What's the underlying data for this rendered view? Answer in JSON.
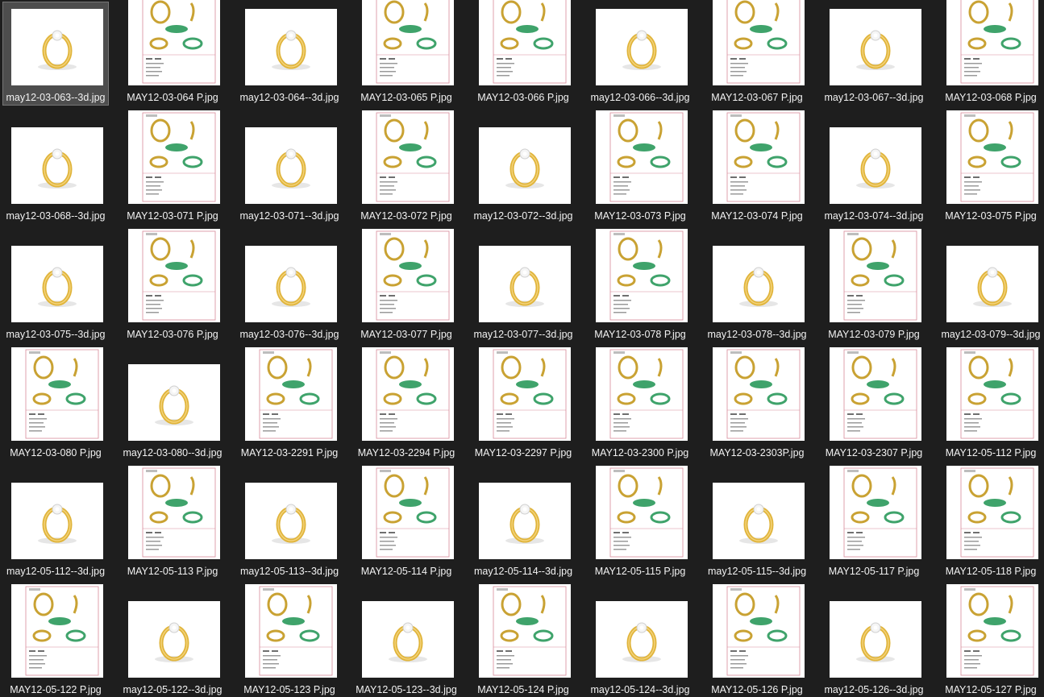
{
  "explorer": {
    "files": [
      {
        "name": "may12-03-063--3d.jpg",
        "kind": "render",
        "selected": true
      },
      {
        "name": "MAY12-03-064 P.jpg",
        "kind": "sheet"
      },
      {
        "name": "may12-03-064--3d.jpg",
        "kind": "render"
      },
      {
        "name": "MAY12-03-065 P.jpg",
        "kind": "sheet"
      },
      {
        "name": "MAY12-03-066 P.jpg",
        "kind": "sheet"
      },
      {
        "name": "may12-03-066--3d.jpg",
        "kind": "render"
      },
      {
        "name": "MAY12-03-067 P.jpg",
        "kind": "sheet"
      },
      {
        "name": "may12-03-067--3d.jpg",
        "kind": "render"
      },
      {
        "name": "MAY12-03-068 P.jpg",
        "kind": "sheet"
      },
      {
        "name": "may12-03-068--3d.jpg",
        "kind": "render"
      },
      {
        "name": "MAY12-03-071 P.jpg",
        "kind": "sheet"
      },
      {
        "name": "may12-03-071--3d.jpg",
        "kind": "render"
      },
      {
        "name": "MAY12-03-072 P.jpg",
        "kind": "sheet"
      },
      {
        "name": "may12-03-072--3d.jpg",
        "kind": "render"
      },
      {
        "name": "MAY12-03-073 P.jpg",
        "kind": "sheet"
      },
      {
        "name": "MAY12-03-074 P.jpg",
        "kind": "sheet"
      },
      {
        "name": "may12-03-074--3d.jpg",
        "kind": "render"
      },
      {
        "name": "MAY12-03-075 P.jpg",
        "kind": "sheet"
      },
      {
        "name": "may12-03-075--3d.jpg",
        "kind": "render"
      },
      {
        "name": "MAY12-03-076 P.jpg",
        "kind": "sheet"
      },
      {
        "name": "may12-03-076--3d.jpg",
        "kind": "render"
      },
      {
        "name": "MAY12-03-077 P.jpg",
        "kind": "sheet"
      },
      {
        "name": "may12-03-077--3d.jpg",
        "kind": "render"
      },
      {
        "name": "MAY12-03-078 P.jpg",
        "kind": "sheet"
      },
      {
        "name": "may12-03-078--3d.jpg",
        "kind": "render"
      },
      {
        "name": "MAY12-03-079 P.jpg",
        "kind": "sheet"
      },
      {
        "name": "may12-03-079--3d.jpg",
        "kind": "render"
      },
      {
        "name": "MAY12-03-080 P.jpg",
        "kind": "sheet"
      },
      {
        "name": "may12-03-080--3d.jpg",
        "kind": "render"
      },
      {
        "name": "MAY12-03-2291 P.jpg",
        "kind": "sheet"
      },
      {
        "name": "MAY12-03-2294 P.jpg",
        "kind": "sheet"
      },
      {
        "name": "MAY12-03-2297  P.jpg",
        "kind": "sheet"
      },
      {
        "name": "MAY12-03-2300 P.jpg",
        "kind": "sheet"
      },
      {
        "name": "MAY12-03-2303P.jpg",
        "kind": "sheet"
      },
      {
        "name": "MAY12-03-2307 P.jpg",
        "kind": "sheet"
      },
      {
        "name": "MAY12-05-112 P.jpg",
        "kind": "sheet"
      },
      {
        "name": "may12-05-112--3d.jpg",
        "kind": "render"
      },
      {
        "name": "MAY12-05-113 P.jpg",
        "kind": "sheet"
      },
      {
        "name": "may12-05-113--3d.jpg",
        "kind": "render"
      },
      {
        "name": "MAY12-05-114 P.jpg",
        "kind": "sheet"
      },
      {
        "name": "may12-05-114--3d.jpg",
        "kind": "render"
      },
      {
        "name": "MAY12-05-115 P.jpg",
        "kind": "sheet"
      },
      {
        "name": "may12-05-115--3d.jpg",
        "kind": "render"
      },
      {
        "name": "MAY12-05-117 P.jpg",
        "kind": "sheet"
      },
      {
        "name": "MAY12-05-118 P.jpg",
        "kind": "sheet"
      },
      {
        "name": "MAY12-05-122 P.jpg",
        "kind": "sheet"
      },
      {
        "name": "may12-05-122--3d.jpg",
        "kind": "render"
      },
      {
        "name": "MAY12-05-123 P.jpg",
        "kind": "sheet"
      },
      {
        "name": "MAY12-05-123--3d.jpg",
        "kind": "render"
      },
      {
        "name": "MAY12-05-124 P.jpg",
        "kind": "sheet"
      },
      {
        "name": "may12-05-124--3d.jpg",
        "kind": "render"
      },
      {
        "name": "MAY12-05-126 P.jpg",
        "kind": "sheet"
      },
      {
        "name": "may12-05-126--3d.jpg",
        "kind": "render"
      },
      {
        "name": "MAY12-05-127 P.jpg",
        "kind": "sheet"
      }
    ]
  },
  "colors": {
    "background": "#1e1e1e",
    "selected_tile": "#4d4d4d",
    "label_text": "#f2f2f2",
    "gold": "#e0b43a",
    "gem_green": "#3fa36b",
    "sheet_rule": "#d88a9a"
  },
  "icons": {
    "render": "ring-render-thumbnail",
    "sheet": "jewelry-spec-sheet-thumbnail"
  }
}
